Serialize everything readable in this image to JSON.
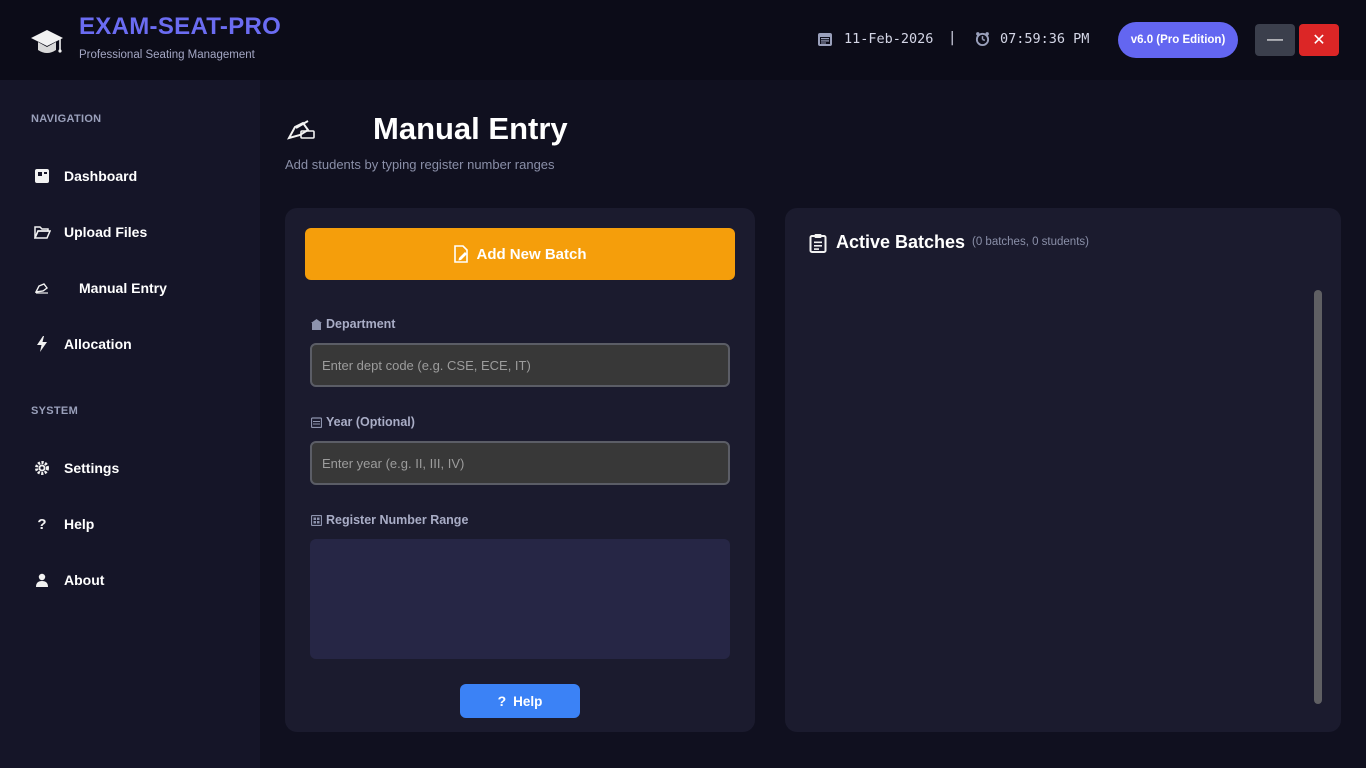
{
  "header": {
    "app_title": "EXAM-SEAT-PRO",
    "app_subtitle": "Professional Seating Management",
    "date": "11-Feb-2026",
    "separator": "|",
    "time": "07:59:36 PM",
    "version_badge": "v6.0 (Pro Edition)",
    "minimize_label": "—",
    "close_label": "✕"
  },
  "sidebar": {
    "navigation_label": "NAVIGATION",
    "system_label": "SYSTEM",
    "nav_items": [
      {
        "label": "Dashboard",
        "icon": "dashboard-icon"
      },
      {
        "label": "Upload Files",
        "icon": "folder-icon"
      },
      {
        "label": "Manual Entry",
        "icon": "pen-icon"
      },
      {
        "label": "Allocation",
        "icon": "lightning-icon"
      }
    ],
    "system_items": [
      {
        "label": "Settings",
        "icon": "gear-icon"
      },
      {
        "label": "Help",
        "icon": "question-icon"
      },
      {
        "label": "About",
        "icon": "user-icon"
      }
    ],
    "active_item": "Manual Entry"
  },
  "main": {
    "page_title": "Manual Entry",
    "page_subtitle": "Add students by typing register number ranges",
    "add_batch_label": "Add New Batch",
    "department_label": "Department",
    "department_placeholder": "Enter dept code (e.g. CSE, ECE, IT)",
    "department_value": "",
    "year_label": "Year (Optional)",
    "year_placeholder": "Enter year (e.g. II, III, IV)",
    "year_value": "",
    "range_label": "Register Number Range",
    "range_value": "",
    "help_label": "Help"
  },
  "batches": {
    "title": "Active Batches",
    "count_text": "(0 batches, 0 students)"
  },
  "colors": {
    "accent": "#6366f1",
    "add_button": "#f59e0b",
    "help_button": "#3b82f6",
    "close_button": "#dc2626"
  }
}
